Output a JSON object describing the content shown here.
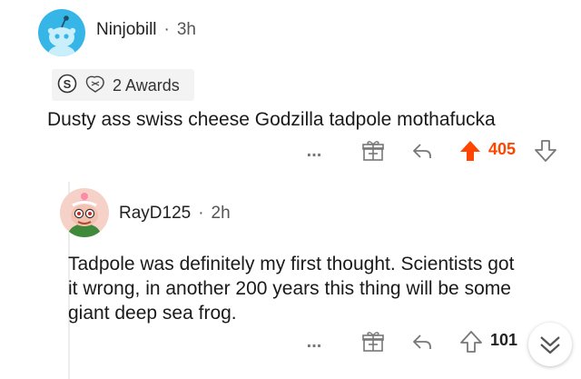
{
  "comment1": {
    "username": "Ninjobill",
    "separator": "·",
    "time": "3h",
    "awards_label": "2 Awards",
    "text": "Dusty ass swiss cheese Godzilla tadpole mothafucka",
    "more": "...",
    "votes": "405",
    "upvote_color": "#ff4500"
  },
  "comment2": {
    "username": "RayD125",
    "separator": "·",
    "time": "2h",
    "text_lines": [
      "Tadpole was definitely my first thought. Scientists got",
      "it wrong, in another 200 years this thing will be some",
      "giant deep sea frog."
    ],
    "more": "...",
    "votes": "101"
  },
  "icons": {
    "gift": "gift-icon",
    "reply": "reply-icon",
    "upvote": "upvote-icon",
    "downvote": "downvote-icon",
    "award1": "silver-award-icon",
    "award2": "helpful-award-icon",
    "scroll": "chevron-down-icon"
  }
}
